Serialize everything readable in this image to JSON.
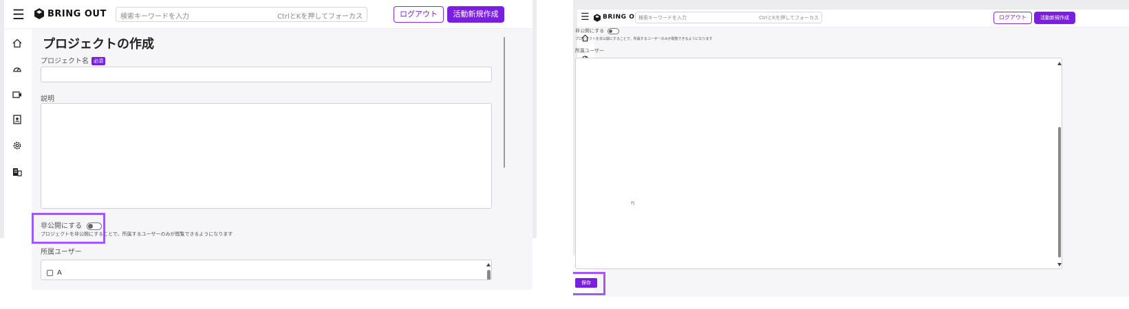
{
  "app": {
    "brand": "BRING OUT",
    "search_placeholder": "検索キーワードを入力",
    "search_hint": "CtrlとKを押してフォーカス",
    "logout_label": "ログアウト",
    "new_activity_label": "活動新規作成"
  },
  "sidebar": {
    "icons": [
      "menu-icon",
      "home-icon",
      "dashboard-icon",
      "video-icon",
      "contact-icon",
      "gear-icon",
      "building-icon"
    ]
  },
  "form": {
    "page_title": "プロジェクトの作成",
    "project_name_label": "プロジェクト名",
    "required_badge": "必須",
    "description_label": "説明",
    "private_label": "非公開にする",
    "private_note": "プロジェクトを非公開にすることで、所属するユーザーのみが閲覧できるようになります",
    "members_label": "所属ユーザー",
    "member_items": [
      "A"
    ],
    "stray_text": "ﾅ)",
    "save_label": "保存"
  },
  "colors": {
    "accent": "#7a1fe0",
    "highlight": "#a855f7",
    "background": "#f6f6f8"
  }
}
